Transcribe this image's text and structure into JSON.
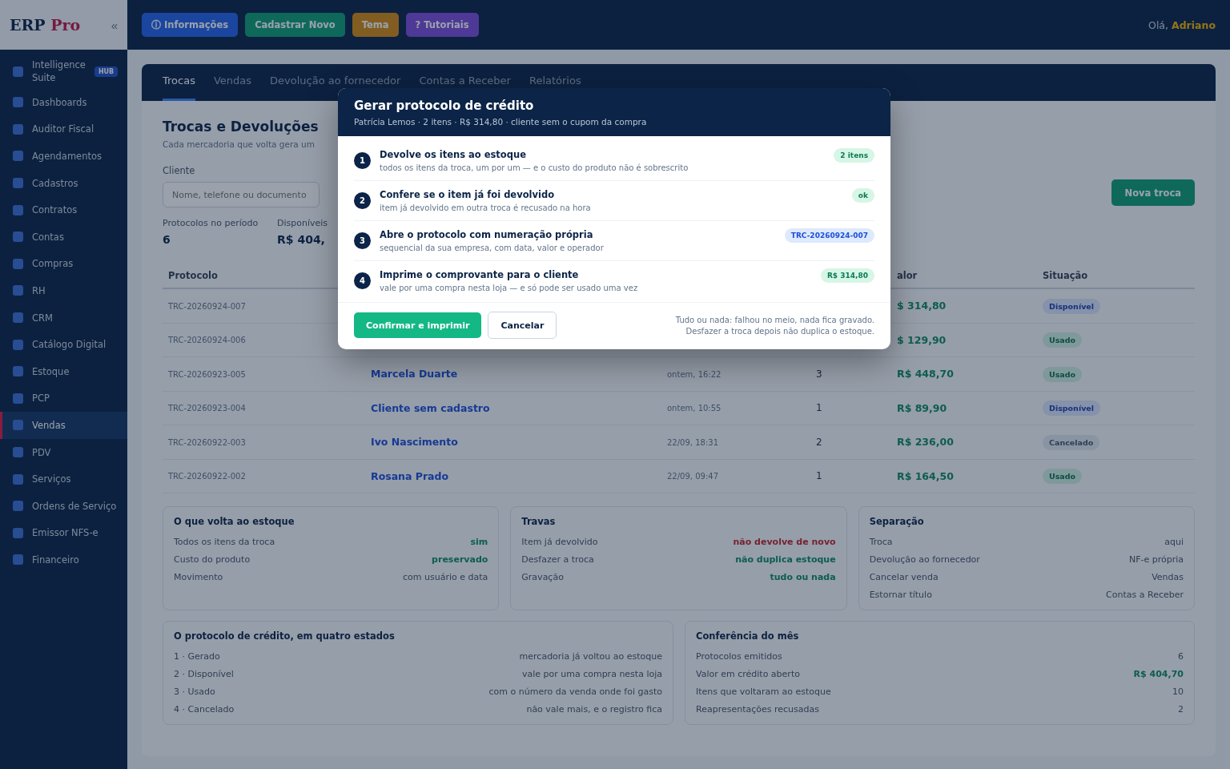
{
  "sidebar": {
    "logo": {
      "first": "ERP",
      "second": "Pro"
    },
    "collapse": "«",
    "items": [
      {
        "label": "Intelligence Suite",
        "badge": "HUB",
        "selected": false
      },
      {
        "label": "Dashboards",
        "selected": false
      },
      {
        "label": "Auditor Fiscal",
        "selected": false
      },
      {
        "label": "Agendamentos",
        "selected": false
      },
      {
        "label": "Cadastros",
        "selected": false
      },
      {
        "label": "Contratos",
        "selected": false
      },
      {
        "label": "Contas",
        "selected": false
      },
      {
        "label": "Compras",
        "selected": false
      },
      {
        "label": "RH",
        "selected": false
      },
      {
        "label": "CRM",
        "selected": false
      },
      {
        "label": "Catálogo Digital",
        "selected": false
      },
      {
        "label": "Estoque",
        "selected": false
      },
      {
        "label": "PCP",
        "selected": false
      },
      {
        "label": "Vendas",
        "selected": true
      },
      {
        "label": "PDV",
        "selected": false
      },
      {
        "label": "Serviços",
        "selected": false
      },
      {
        "label": "Ordens de Serviço",
        "selected": false
      },
      {
        "label": "Emissor NFS-e",
        "selected": false
      },
      {
        "label": "Financeiro",
        "selected": false
      }
    ]
  },
  "topbar": {
    "buttons": [
      {
        "label": "ⓘ Informações"
      },
      {
        "label": "Cadastrar Novo"
      },
      {
        "label": "Tema"
      },
      {
        "label": "? Tutoriais"
      }
    ],
    "greeting": "Olá,",
    "user": "Adriano"
  },
  "tabs": [
    {
      "label": "Trocas",
      "selected": true
    },
    {
      "label": "Vendas",
      "selected": false
    },
    {
      "label": "Devolução ao fornecedor",
      "selected": false
    },
    {
      "label": "Contas a Receber",
      "selected": false
    },
    {
      "label": "Relatórios",
      "selected": false
    }
  ],
  "page": {
    "title": "Trocas e Devoluções",
    "subtitle": "Cada mercadoria que volta gera um",
    "filters": {
      "label": "Cliente",
      "placeholder": "Nome, telefone ou documento"
    },
    "new_button": "Nova troca",
    "stats": [
      {
        "label": "Protocolos no período",
        "value": "6"
      },
      {
        "label": "Disponíveis",
        "value": "R$ 404,"
      }
    ]
  },
  "table": {
    "columns": [
      "Protocolo",
      "",
      "",
      "",
      "alor",
      "Situação"
    ],
    "rows": [
      {
        "protocol": "TRC-20260924-007",
        "value": "$ 314,80",
        "status": "Disponível",
        "kind": "available"
      },
      {
        "protocol": "TRC-20260924-006",
        "value": "$ 129,90",
        "status": "Usado",
        "kind": "used"
      },
      {
        "protocol": "TRC-20260923-005",
        "client": "Marcela Duarte",
        "date": "ontem, 16:22",
        "items": "3",
        "value": "R$ 448,70",
        "status": "Usado",
        "kind": "used"
      },
      {
        "protocol": "TRC-20260923-004",
        "client": "Cliente sem cadastro",
        "date": "ontem, 10:55",
        "items": "1",
        "value": "R$ 89,90",
        "status": "Disponível",
        "kind": "available"
      },
      {
        "protocol": "TRC-20260922-003",
        "client": "Ivo Nascimento",
        "date": "22/09, 18:31",
        "items": "2",
        "value": "R$ 236,00",
        "status": "Cancelado",
        "kind": "cancelled"
      },
      {
        "protocol": "TRC-20260922-002",
        "client": "Rosana Prado",
        "date": "22/09, 09:47",
        "items": "1",
        "value": "R$ 164,50",
        "status": "Usado",
        "kind": "used"
      }
    ]
  },
  "cards": [
    {
      "title": "O que volta ao estoque",
      "rows": [
        {
          "label": "Todos os itens da troca",
          "value": "sim",
          "kind": "positive"
        },
        {
          "label": "Custo do produto",
          "value": "preservado",
          "kind": "positive"
        },
        {
          "label": "Movimento",
          "value": "com usuário e data",
          "kind": "plain"
        }
      ]
    },
    {
      "title": "Travas",
      "rows": [
        {
          "label": "Item já devolvido",
          "value": "não devolve de novo",
          "kind": "negative"
        },
        {
          "label": "Desfazer a troca",
          "value": "não duplica estoque",
          "kind": "positive"
        },
        {
          "label": "Gravação",
          "value": "tudo ou nada",
          "kind": "positive"
        }
      ]
    },
    {
      "title": "Separação",
      "rows": [
        {
          "label": "Troca",
          "value": "aqui",
          "kind": "plain"
        },
        {
          "label": "Devolução ao fornecedor",
          "value": "NF-e própria",
          "kind": "plain"
        },
        {
          "label": "Cancelar venda",
          "value": "Vendas",
          "kind": "plain"
        },
        {
          "label": "Estornar título",
          "value": "Contas a Receber",
          "kind": "plain"
        }
      ]
    },
    {
      "title": "O protocolo de crédito, em quatro estados",
      "rows": [
        {
          "label": "1 · Gerado",
          "value": "mercadoria já voltou ao estoque",
          "kind": "plain"
        },
        {
          "label": "2 · Disponível",
          "value": "vale por uma compra nesta loja",
          "kind": "plain"
        },
        {
          "label": "3 · Usado",
          "value": "com o número da venda onde foi gasto",
          "kind": "plain"
        },
        {
          "label": "4 · Cancelado",
          "value": "não vale mais, e o registro fica",
          "kind": "plain"
        }
      ]
    },
    {
      "title": "Conferência do mês",
      "rows": [
        {
          "label": "Protocolos emitidos",
          "value": "6",
          "kind": "plain"
        },
        {
          "label": "Valor em crédito aberto",
          "value": "R$ 404,70",
          "kind": "positive"
        },
        {
          "label": "Itens que voltaram ao estoque",
          "value": "10",
          "kind": "plain"
        },
        {
          "label": "Reapresentações recusadas",
          "value": "2",
          "kind": "plain"
        }
      ]
    }
  ],
  "modal": {
    "title": "Gerar protocolo de crédito",
    "subtitle": "Patrícia Lemos · 2 itens · R$ 314,80 · cliente sem o cupom da compra",
    "steps": [
      {
        "number": "1",
        "title": "Devolve os itens ao estoque",
        "description": "todos os itens da troca, um por um — e o custo do produto não é sobrescrito",
        "pill": "2 itens",
        "kind": "success"
      },
      {
        "number": "2",
        "title": "Confere se o item já foi devolvido",
        "description": "item já devolvido em outra troca é recusado na hora",
        "pill": "ok",
        "kind": "success"
      },
      {
        "number": "3",
        "title": "Abre o protocolo com numeração própria",
        "description": "sequencial da sua empresa, com data, valor e operador",
        "pill": "TRC-20260924-007",
        "kind": "info"
      },
      {
        "number": "4",
        "title": "Imprime o comprovante para o cliente",
        "description": "vale por uma compra nesta loja — e só pode ser usado uma vez",
        "pill": "R$ 314,80",
        "kind": "success"
      }
    ],
    "confirm": "Confirmar e imprimir",
    "cancel": "Cancelar",
    "notes": [
      "Tudo ou nada: falhou no meio, nada fica gravado.",
      "Desfazer a troca depois não duplica o estoque."
    ]
  }
}
